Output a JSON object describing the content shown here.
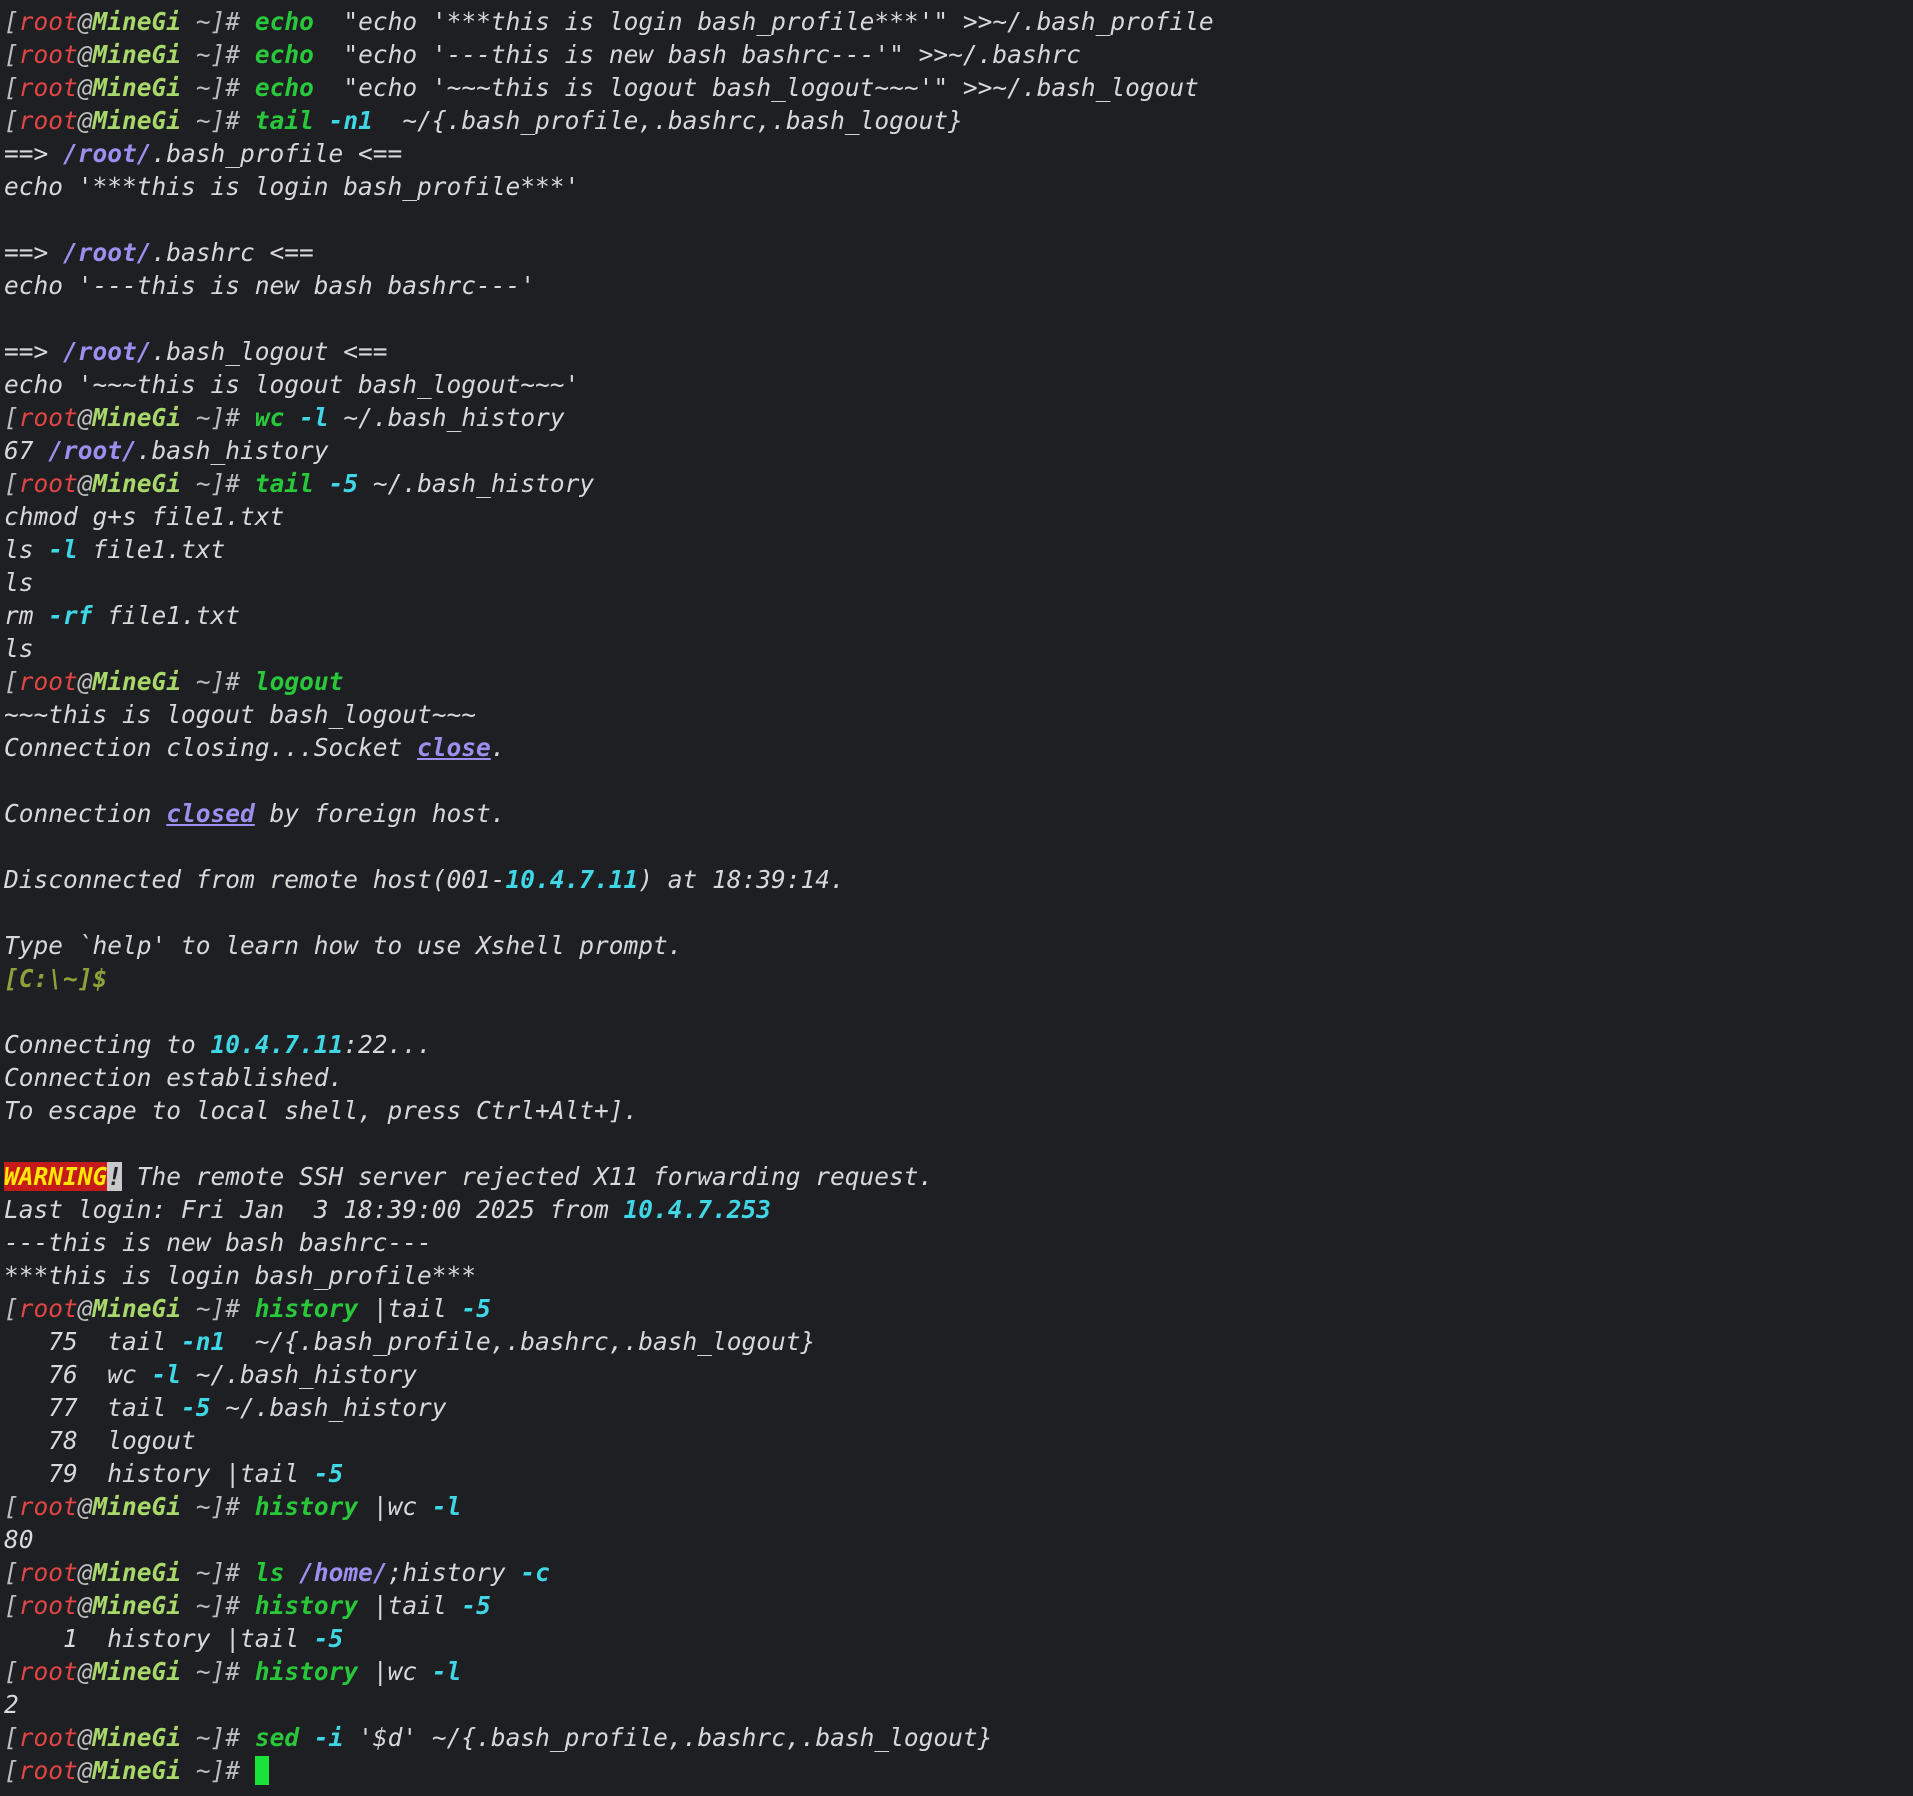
{
  "terminal": {
    "lines": [
      [
        [
          "br",
          "["
        ],
        [
          "u",
          "root"
        ],
        [
          "br",
          "@"
        ],
        [
          "h",
          "MineGi"
        ],
        [
          "br",
          " ~]"
        ],
        [
          "br",
          "# "
        ],
        [
          "cmd",
          "echo"
        ],
        [
          "",
          "  \"echo '***this is login bash_profile***'\" >>~/.bash_profile"
        ]
      ],
      [
        [
          "br",
          "["
        ],
        [
          "u",
          "root"
        ],
        [
          "br",
          "@"
        ],
        [
          "h",
          "MineGi"
        ],
        [
          "br",
          " ~]"
        ],
        [
          "br",
          "# "
        ],
        [
          "cmd",
          "echo"
        ],
        [
          "",
          "  \"echo '---this is new bash bashrc---'\" >>~/.bashrc"
        ]
      ],
      [
        [
          "br",
          "["
        ],
        [
          "u",
          "root"
        ],
        [
          "br",
          "@"
        ],
        [
          "h",
          "MineGi"
        ],
        [
          "br",
          " ~]"
        ],
        [
          "br",
          "# "
        ],
        [
          "cmd",
          "echo"
        ],
        [
          "",
          "  \"echo '~~~this is logout bash_logout~~~'\" >>~/.bash_logout"
        ]
      ],
      [
        [
          "br",
          "["
        ],
        [
          "u",
          "root"
        ],
        [
          "br",
          "@"
        ],
        [
          "h",
          "MineGi"
        ],
        [
          "br",
          " ~]"
        ],
        [
          "br",
          "# "
        ],
        [
          "cmd",
          "tail"
        ],
        [
          "",
          " "
        ],
        [
          "fl",
          "-n1"
        ],
        [
          "",
          "  ~/{.bash_profile,.bashrc,.bash_logout}"
        ]
      ],
      [
        [
          "",
          "==> "
        ],
        [
          "pth",
          "/root/"
        ],
        [
          "",
          ".bash_profile <=="
        ]
      ],
      [
        [
          "",
          "echo '***this is login bash_profile***'"
        ]
      ],
      [],
      [
        [
          "",
          "==> "
        ],
        [
          "pth",
          "/root/"
        ],
        [
          "",
          ".bashrc <=="
        ]
      ],
      [
        [
          "",
          "echo '---this is new bash bashrc---'"
        ]
      ],
      [],
      [
        [
          "",
          "==> "
        ],
        [
          "pth",
          "/root/"
        ],
        [
          "",
          ".bash_logout <=="
        ]
      ],
      [
        [
          "",
          "echo '~~~this is logout bash_logout~~~'"
        ]
      ],
      [
        [
          "br",
          "["
        ],
        [
          "u",
          "root"
        ],
        [
          "br",
          "@"
        ],
        [
          "h",
          "MineGi"
        ],
        [
          "br",
          " ~]"
        ],
        [
          "br",
          "# "
        ],
        [
          "cmd",
          "wc"
        ],
        [
          "",
          " "
        ],
        [
          "fl",
          "-l"
        ],
        [
          "",
          " ~/.bash_history"
        ]
      ],
      [
        [
          "",
          "67 "
        ],
        [
          "pth",
          "/root/"
        ],
        [
          "",
          ".bash_history"
        ]
      ],
      [
        [
          "br",
          "["
        ],
        [
          "u",
          "root"
        ],
        [
          "br",
          "@"
        ],
        [
          "h",
          "MineGi"
        ],
        [
          "br",
          " ~]"
        ],
        [
          "br",
          "# "
        ],
        [
          "cmd",
          "tail"
        ],
        [
          "",
          " "
        ],
        [
          "fl",
          "-5"
        ],
        [
          "",
          " ~/.bash_history"
        ]
      ],
      [
        [
          "",
          "chmod g+s file1.txt"
        ]
      ],
      [
        [
          "",
          "ls "
        ],
        [
          "fl",
          "-l"
        ],
        [
          "",
          " file1.txt"
        ]
      ],
      [
        [
          "",
          "ls"
        ]
      ],
      [
        [
          "",
          "rm "
        ],
        [
          "fl",
          "-rf"
        ],
        [
          "",
          " file1.txt"
        ]
      ],
      [
        [
          "",
          "ls"
        ]
      ],
      [
        [
          "br",
          "["
        ],
        [
          "u",
          "root"
        ],
        [
          "br",
          "@"
        ],
        [
          "h",
          "MineGi"
        ],
        [
          "br",
          " ~]"
        ],
        [
          "br",
          "# "
        ],
        [
          "cmd",
          "logout"
        ]
      ],
      [
        [
          "",
          "~~~this is logout bash_logout~~~"
        ]
      ],
      [
        [
          "",
          "Connection closing...Socket "
        ],
        [
          "kw",
          "close"
        ],
        [
          "",
          "."
        ]
      ],
      [],
      [
        [
          "",
          "Connection "
        ],
        [
          "kw",
          "closed"
        ],
        [
          "",
          " by foreign host."
        ]
      ],
      [],
      [
        [
          "",
          "Disconnected from remote host(001-"
        ],
        [
          "ip",
          "10.4.7.11"
        ],
        [
          "",
          ") at 18:39:14."
        ]
      ],
      [],
      [
        [
          "",
          "Type `help' to learn how to use Xshell prompt."
        ]
      ],
      [
        [
          "lp",
          "[C:\\~]$"
        ]
      ],
      [],
      [
        [
          "",
          "Connecting to "
        ],
        [
          "ip",
          "10.4.7.11"
        ],
        [
          "",
          ":22..."
        ]
      ],
      [
        [
          "",
          "Connection established."
        ]
      ],
      [
        [
          "",
          "To escape to local shell, press Ctrl+Alt+]."
        ]
      ],
      [],
      [
        [
          "warn",
          "WARNING"
        ],
        [
          "bang",
          "!"
        ],
        [
          "",
          " The remote SSH server rejected X11 forwarding request."
        ]
      ],
      [
        [
          "",
          "Last login: Fri Jan  3 18:39:00 2025 from "
        ],
        [
          "ip",
          "10.4.7.253"
        ]
      ],
      [
        [
          "",
          "---this is new bash bashrc---"
        ]
      ],
      [
        [
          "",
          "***this is login bash_profile***"
        ]
      ],
      [
        [
          "br",
          "["
        ],
        [
          "u",
          "root"
        ],
        [
          "br",
          "@"
        ],
        [
          "h",
          "MineGi"
        ],
        [
          "br",
          " ~]"
        ],
        [
          "br",
          "# "
        ],
        [
          "cmd",
          "history"
        ],
        [
          "",
          " |tail "
        ],
        [
          "fl",
          "-5"
        ]
      ],
      [
        [
          "",
          "   75  tail "
        ],
        [
          "fl",
          "-n1"
        ],
        [
          "",
          "  ~/{.bash_profile,.bashrc,.bash_logout}"
        ]
      ],
      [
        [
          "",
          "   76  wc "
        ],
        [
          "fl",
          "-l"
        ],
        [
          "",
          " ~/.bash_history"
        ]
      ],
      [
        [
          "",
          "   77  tail "
        ],
        [
          "fl",
          "-5"
        ],
        [
          "",
          " ~/.bash_history"
        ]
      ],
      [
        [
          "",
          "   78  logout"
        ]
      ],
      [
        [
          "",
          "   79  history |tail "
        ],
        [
          "fl",
          "-5"
        ]
      ],
      [
        [
          "br",
          "["
        ],
        [
          "u",
          "root"
        ],
        [
          "br",
          "@"
        ],
        [
          "h",
          "MineGi"
        ],
        [
          "br",
          " ~]"
        ],
        [
          "br",
          "# "
        ],
        [
          "cmd",
          "history"
        ],
        [
          "",
          " |wc "
        ],
        [
          "fl",
          "-l"
        ]
      ],
      [
        [
          "",
          "80"
        ]
      ],
      [
        [
          "br",
          "["
        ],
        [
          "u",
          "root"
        ],
        [
          "br",
          "@"
        ],
        [
          "h",
          "MineGi"
        ],
        [
          "br",
          " ~]"
        ],
        [
          "br",
          "# "
        ],
        [
          "cmd",
          "ls"
        ],
        [
          "",
          " "
        ],
        [
          "pth",
          "/home/"
        ],
        [
          "",
          ";history "
        ],
        [
          "fl",
          "-c"
        ]
      ],
      [
        [
          "br",
          "["
        ],
        [
          "u",
          "root"
        ],
        [
          "br",
          "@"
        ],
        [
          "h",
          "MineGi"
        ],
        [
          "br",
          " ~]"
        ],
        [
          "br",
          "# "
        ],
        [
          "cmd",
          "history"
        ],
        [
          "",
          " |tail "
        ],
        [
          "fl",
          "-5"
        ]
      ],
      [
        [
          "",
          "    1  history |tail "
        ],
        [
          "fl",
          "-5"
        ]
      ],
      [
        [
          "br",
          "["
        ],
        [
          "u",
          "root"
        ],
        [
          "br",
          "@"
        ],
        [
          "h",
          "MineGi"
        ],
        [
          "br",
          " ~]"
        ],
        [
          "br",
          "# "
        ],
        [
          "cmd",
          "history"
        ],
        [
          "",
          " |wc "
        ],
        [
          "fl",
          "-l"
        ]
      ],
      [
        [
          "",
          "2"
        ]
      ],
      [
        [
          "br",
          "["
        ],
        [
          "u",
          "root"
        ],
        [
          "br",
          "@"
        ],
        [
          "h",
          "MineGi"
        ],
        [
          "br",
          " ~]"
        ],
        [
          "br",
          "# "
        ],
        [
          "cmd",
          "sed"
        ],
        [
          "",
          " "
        ],
        [
          "fl",
          "-i"
        ],
        [
          "",
          " '$d' ~/{.bash_profile,.bashrc,.bash_logout}"
        ]
      ],
      [
        [
          "br",
          "["
        ],
        [
          "u",
          "root"
        ],
        [
          "br",
          "@"
        ],
        [
          "h",
          "MineGi"
        ],
        [
          "br",
          " ~]"
        ],
        [
          "br",
          "# "
        ],
        [
          "cursor",
          ""
        ]
      ]
    ]
  },
  "colors": {
    "background": "#1e1f22",
    "text": "#d8d8d8",
    "user": "#e34545",
    "host": "#a8d86a",
    "command": "#29c83b",
    "flag": "#3fd7e6",
    "path": "#9b8ff0",
    "cursor": "#19e33a",
    "warning_bg": "#c61a1a",
    "warning_fg": "#ffe800"
  }
}
